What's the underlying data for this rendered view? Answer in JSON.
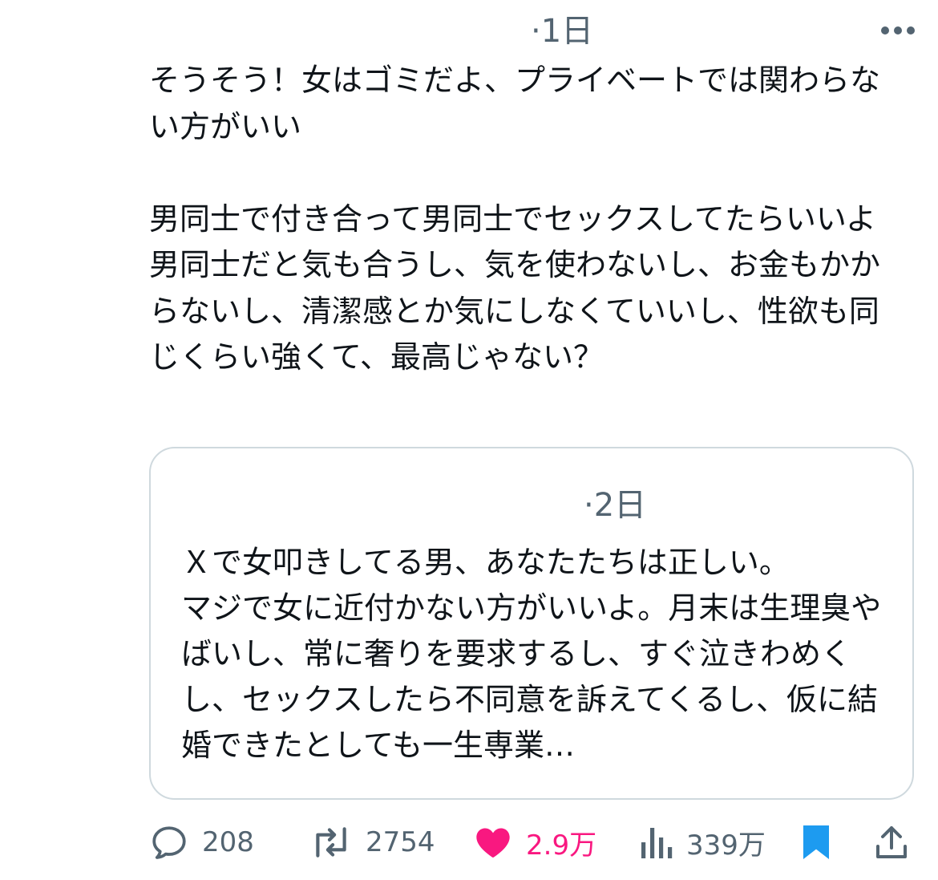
{
  "tweet": {
    "time": "·1日",
    "text": "そうそう！女はゴミだよ、プライベートでは関わらない方がいい\n\n男同士で付き合って男同士でセックスしてたらいいよ\n男同士だと気も合うし、気を使わないし、お金もかからないし、清潔感とか気にしなくていいし、性欲も同じくらい強くて、最高じゃない？"
  },
  "quote": {
    "time": "·2日",
    "text": "Ｘで女叩きしてる男、あなたたちは正しい。\nマジで女に近付かない方がいいよ。月末は生理臭やばいし、常に奢りを要求するし、すぐ泣きわめくし、セックスしたら不同意を訴えてくるし、仮に結婚できたとしても一生専業…"
  },
  "actions": {
    "replies": "208",
    "retweets": "2754",
    "likes": "2.9万",
    "views": "339万"
  },
  "icons": {
    "more": "more-dots-icon",
    "reply": "reply-icon",
    "retweet": "retweet-icon",
    "like": "heart-icon",
    "views": "views-chart-icon",
    "bookmark": "bookmark-icon",
    "share": "share-icon"
  },
  "colors": {
    "like": "#f91880",
    "bookmark": "#1d9bf0",
    "secondary": "#536471"
  }
}
